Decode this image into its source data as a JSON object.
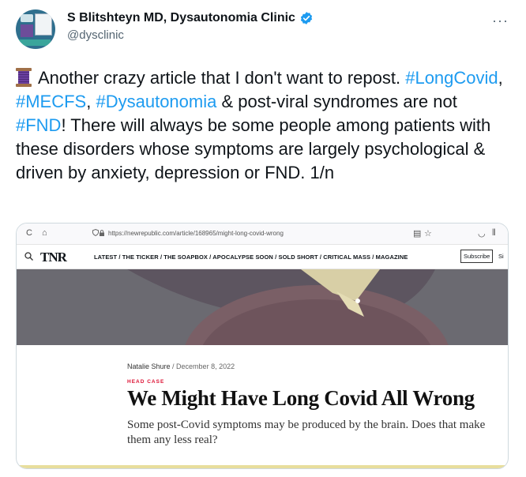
{
  "tweet": {
    "author_name": "S Blitshteyn MD, Dysautonomia Clinic",
    "handle": "@dysclinic",
    "more_label": "···",
    "body": {
      "emoji": "spool-of-thread",
      "t1": "Another crazy article that I don't want to repost. ",
      "h1": "#LongCovid",
      "t2": ", ",
      "h2": "#MECFS",
      "t3": ", ",
      "h3": "#Dysautonomia",
      "t4": " & post-viral syndromes are not ",
      "h4": "#FND",
      "t5": "! There will always be some people among patients with these disorders whose symptoms are largely psychological & driven by anxiety, depression or FND. 1/n"
    },
    "link_color": "#1d9bf0"
  },
  "screenshot": {
    "browser": {
      "url": "https://newrepublic.com/article/168965/might-long-covid-wrong",
      "back_icon": "reload-icon",
      "home_icon": "home-icon"
    },
    "site": {
      "logo": "TNR",
      "nav": "LATEST / THE TICKER / THE SOAPBOX / APOCALYPSE SOON / SOLD SHORT / CRITICAL MASS / MAGAZINE",
      "subscribe": "Subscribe",
      "sign": "Si"
    },
    "article": {
      "author": "Natalie Shure",
      "date": " / December 8, 2022",
      "kicker": "HEAD CASE",
      "headline": "We Might Have Long Covid All Wrong",
      "dek": "Some post-Covid symptoms may be produced by the brain. Does that make them any less real?"
    }
  }
}
